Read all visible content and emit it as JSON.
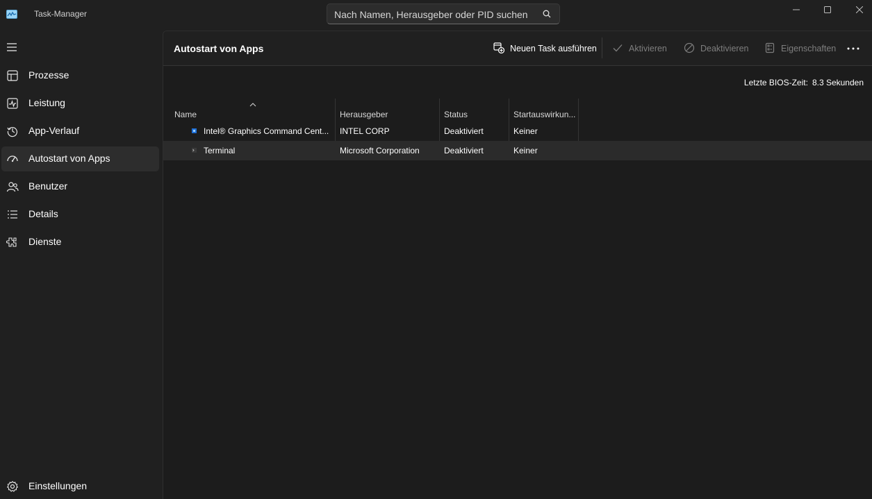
{
  "window": {
    "title": "Task-Manager",
    "icon": "task-manager-icon",
    "controls": [
      "minimize-icon",
      "maximize-icon",
      "close-icon"
    ]
  },
  "search": {
    "placeholder": "Nach Namen, Herausgeber oder PID suchen",
    "icon": "search-icon"
  },
  "sidebar": {
    "menu_icon": "hamburger-icon",
    "items": [
      {
        "label": "Prozesse",
        "icon": "processes-icon",
        "active": false
      },
      {
        "label": "Leistung",
        "icon": "performance-icon",
        "active": false
      },
      {
        "label": "App-Verlauf",
        "icon": "history-icon",
        "active": false
      },
      {
        "label": "Autostart von Apps",
        "icon": "startup-icon",
        "active": true
      },
      {
        "label": "Benutzer",
        "icon": "users-icon",
        "active": false
      },
      {
        "label": "Details",
        "icon": "details-icon",
        "active": false
      },
      {
        "label": "Dienste",
        "icon": "services-icon",
        "active": false
      }
    ],
    "settings_label": "Einstellungen",
    "settings_icon": "gear-icon"
  },
  "toolbar": {
    "page_title": "Autostart von Apps",
    "new_task": "Neuen Task ausführen",
    "enable": "Aktivieren",
    "disable": "Deaktivieren",
    "properties": "Eigenschaften",
    "more_icon": "more-icon"
  },
  "bios": {
    "label": "Letzte BIOS-Zeit:",
    "value": "8.3 Sekunden"
  },
  "table": {
    "columns": [
      "Name",
      "Herausgeber",
      "Status",
      "Startauswirkun..."
    ],
    "sort_column": "Name",
    "rows": [
      {
        "name": "Intel® Graphics Command Cent...",
        "publisher": "INTEL CORP",
        "status": "Deaktiviert",
        "impact": "Keiner",
        "icon": "intel-graphics-icon",
        "selected": false
      },
      {
        "name": "Terminal",
        "publisher": "Microsoft Corporation",
        "status": "Deaktiviert",
        "impact": "Keiner",
        "icon": "terminal-icon",
        "selected": true
      }
    ]
  },
  "colors": {
    "background": "#202020",
    "content": "#1c1c1c",
    "active_nav": "#2d2d2d",
    "selected_row": "#2b2b2b",
    "accent": "#4cc2ff"
  }
}
